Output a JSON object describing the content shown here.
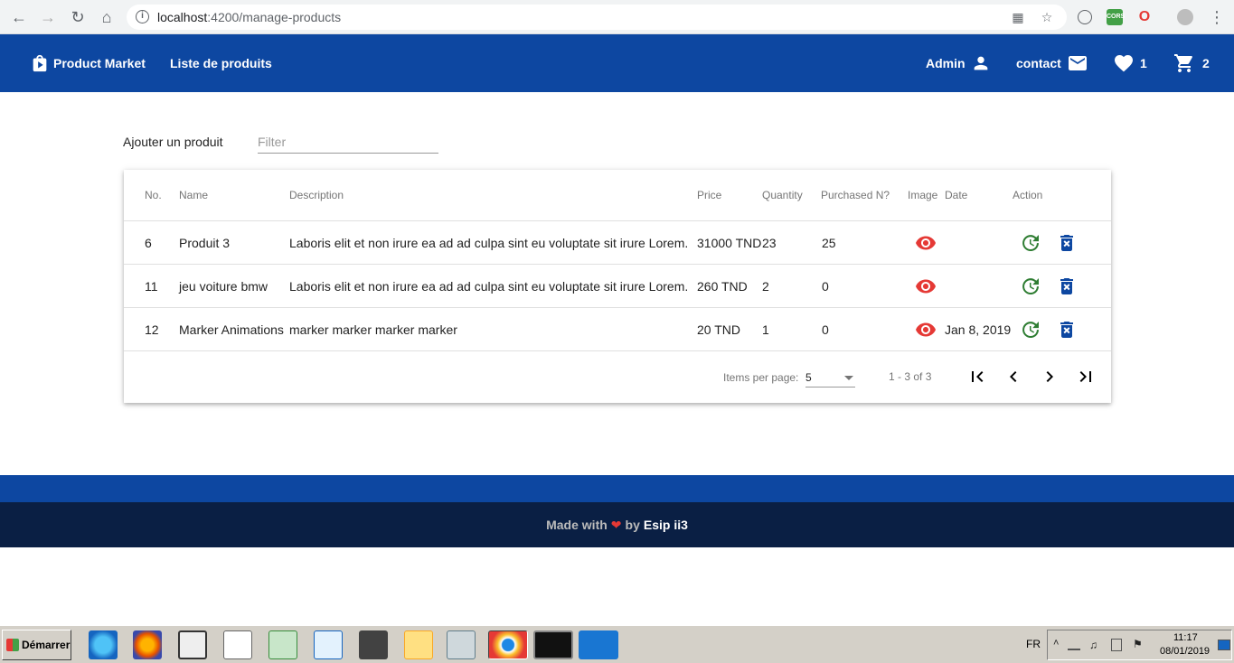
{
  "browser": {
    "url_host": "localhost",
    "url_path": ":4200/manage-products"
  },
  "header": {
    "brand": "Product Market",
    "nav_products": "Liste de produits",
    "admin": "Admin",
    "contact": "contact",
    "wishlist_count": "1",
    "cart_count": "2",
    "color": "#0d47a1"
  },
  "toolbar": {
    "add_label": "Ajouter un produit",
    "filter_placeholder": "Filter"
  },
  "table": {
    "columns": [
      "No.",
      "Name",
      "Description",
      "Price",
      "Quantity",
      "Purchased N?",
      "Image",
      "Date",
      "Action"
    ],
    "rows": [
      {
        "no": "6",
        "name": "Produit 3",
        "description": "Laboris elit et non irure ea ad ad culpa sint eu voluptate sit irure Lorem.",
        "price": "31000 TND",
        "quantity": "23",
        "purchased": "25",
        "date": ""
      },
      {
        "no": "11",
        "name": "jeu voiture bmw",
        "description": "Laboris elit et non irure ea ad ad culpa sint eu voluptate sit irure Lorem.",
        "price": "260 TND",
        "quantity": "2",
        "purchased": "0",
        "date": ""
      },
      {
        "no": "12",
        "name": "Marker Animations",
        "description": "marker marker marker marker",
        "price": "20 TND",
        "quantity": "1",
        "purchased": "0",
        "date": "Jan 8, 2019"
      }
    ]
  },
  "paginator": {
    "items_per_page_label": "Items per page:",
    "page_size": "5",
    "range_label": "1 - 3 of 3"
  },
  "footer": {
    "made_with": "Made with",
    "by": "by",
    "brand": "Esip ii3"
  },
  "taskbar": {
    "start": "Démarrer",
    "lang": "FR",
    "time": "11:17",
    "date": "08/01/2019"
  }
}
